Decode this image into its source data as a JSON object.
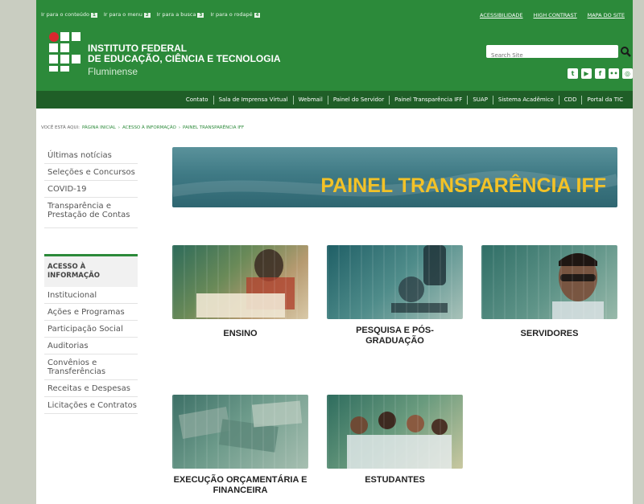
{
  "skip_links": [
    {
      "label": "Ir para o conteúdo",
      "key": "1"
    },
    {
      "label": "Ir para o menu",
      "key": "2"
    },
    {
      "label": "Ir para a busca",
      "key": "3"
    },
    {
      "label": "Ir para o rodapé",
      "key": "4"
    }
  ],
  "top_links": [
    "ACESSIBILIDADE",
    "HIGH CONTRAST",
    "MAPA DO SITE"
  ],
  "institution": {
    "line1": "INSTITUTO FEDERAL",
    "line2": "DE EDUCAÇÃO, CIÊNCIA E TECNOLOGIA",
    "campus": "Fluminense"
  },
  "search": {
    "placeholder": "Search Site"
  },
  "nav": [
    "Contato",
    "Sala de Imprensa Virtual",
    "Webmail",
    "Painel do Servidor",
    "Painel Transparência IFF",
    "SUAP",
    "Sistema Acadêmico",
    "CDD",
    "Portal da TIC"
  ],
  "breadcrumb": {
    "label": "VOCÊ ESTÁ AQUI:",
    "items": [
      "PÁGINA INICIAL",
      "ACESSO À INFORMAÇÃO",
      "PAINEL TRANSPARÊNCIA IFF"
    ]
  },
  "sidebar": {
    "items": [
      "Últimas notícias",
      "Seleções e Concursos",
      "COVID-19",
      "Transparência e Prestação de Contas"
    ],
    "heading": "ACESSO À INFORMAÇÃO",
    "sub_items": [
      "Institucional",
      "Ações e Programas",
      "Participação Social",
      "Auditorias",
      "Convênios e Transferências",
      "Receitas e Despesas",
      "Licitações e Contratos"
    ]
  },
  "banner": {
    "title": "PAINEL TRANSPARÊNCIA IFF"
  },
  "cards": [
    {
      "label": "ENSINO"
    },
    {
      "label": "PESQUISA E PÓS-GRADUAÇÃO"
    },
    {
      "label": "SERVIDORES"
    },
    {
      "label": "EXECUÇÃO ORÇAMENTÁRIA E FINANCEIRA"
    },
    {
      "label": "ESTUDANTES"
    }
  ],
  "colors": {
    "header_green": "#2c8a3a",
    "nav_green": "#1f5e27",
    "banner_teal": "#3f7a85",
    "banner_text": "#f3c227"
  }
}
